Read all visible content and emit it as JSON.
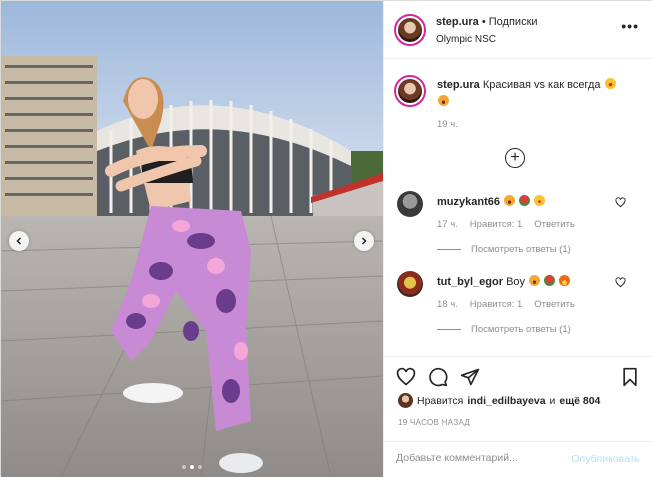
{
  "post": {
    "username": "step.ura",
    "follow_label": "• Подписки",
    "location": "Olympic NSC",
    "caption": "Красивая vs как всегда",
    "caption_time": "19 ч.",
    "carousel": {
      "slide_count": 3,
      "active_slide": 2
    }
  },
  "comments": [
    {
      "username": "muzykant66",
      "text": "",
      "time": "17 ч.",
      "likes_label": "Нравится: 1",
      "reply_label": "Ответить",
      "replies_label": "Посмотреть ответы (1)"
    },
    {
      "username": "tut_byl_egor",
      "text": "Boy",
      "time": "18 ч.",
      "likes_label": "Нравится: 1",
      "reply_label": "Ответить",
      "replies_label": "Посмотреть ответы (1)"
    }
  ],
  "likes": {
    "prefix": "Нравится",
    "user": "indi_edilbayeva",
    "connector": "и",
    "rest": "ещё 804"
  },
  "time_ago": "19 ЧАСОВ НАЗАД",
  "composer": {
    "placeholder": "Добавьте комментарий...",
    "publish_label": "Опубликовать"
  },
  "colors": {
    "accent_blue_disabled": "#b2dffc",
    "story_ring": "#d6249f",
    "secondary_text": "#8e8e8e"
  }
}
